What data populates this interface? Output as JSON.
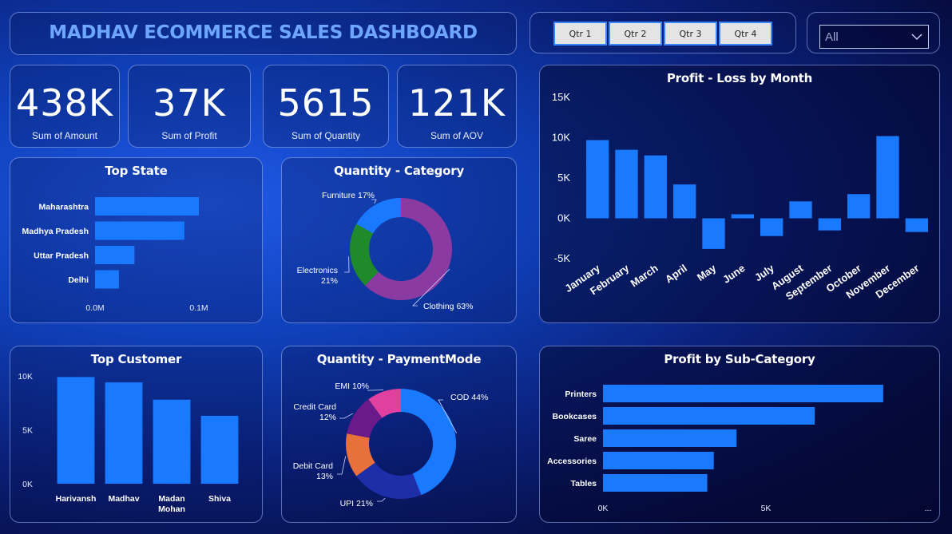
{
  "header": {
    "title": "MADHAV ECOMMERCE SALES DASHBOARD"
  },
  "quarter_buttons": [
    "Qtr 1",
    "Qtr 2",
    "Qtr 3",
    "Qtr 4"
  ],
  "filter": {
    "selected": "All"
  },
  "kpis": [
    {
      "value": "438K",
      "label": "Sum of Amount"
    },
    {
      "value": "37K",
      "label": "Sum of Profit"
    },
    {
      "value": "5615",
      "label": "Sum of Quantity"
    },
    {
      "value": "121K",
      "label": "Sum of AOV"
    }
  ],
  "colors": {
    "bar": "#1a7aff",
    "accent_title": "#6ea6ff"
  },
  "chart_data": [
    {
      "id": "top-state",
      "type": "bar",
      "orientation": "horizontal",
      "title": "Top State",
      "categories": [
        "Maharashtra",
        "Madhya Pradesh",
        "Uttar Pradesh",
        "Delhi"
      ],
      "values": [
        0.1,
        0.086,
        0.038,
        0.023
      ],
      "xticks": [
        "0.0M",
        "0.1M"
      ],
      "xlim": [
        0,
        0.1
      ]
    },
    {
      "id": "quantity-category",
      "type": "pie",
      "donut": true,
      "title": "Quantity - Category",
      "labels": [
        "Clothing 63%",
        "Electronics\n21%",
        "Furniture 17%"
      ],
      "values": [
        63,
        21,
        17
      ],
      "colors": [
        "#8a3aa0",
        "#1e8a2a",
        "#1a7aff"
      ]
    },
    {
      "id": "profit-loss-month",
      "type": "bar",
      "title": "Profit - Loss by Month",
      "categories": [
        "January",
        "February",
        "March",
        "April",
        "May",
        "June",
        "July",
        "August",
        "September",
        "October",
        "November",
        "December"
      ],
      "values": [
        9700,
        8500,
        7800,
        4200,
        -3800,
        500,
        -2200,
        2100,
        -1500,
        3000,
        10200,
        -1700
      ],
      "yticks": [
        "15K",
        "10K",
        "5K",
        "0K",
        "-5K"
      ],
      "ylim": [
        -5000,
        15000
      ]
    },
    {
      "id": "top-customer",
      "type": "bar",
      "title": "Top Customer",
      "categories": [
        "Harivansh",
        "Madhav",
        "Madan\nMohan",
        "Shiva"
      ],
      "values": [
        9900,
        9400,
        7800,
        6300
      ],
      "yticks": [
        "10K",
        "5K",
        "0K"
      ],
      "ylim": [
        0,
        10000
      ]
    },
    {
      "id": "quantity-paymentmode",
      "type": "pie",
      "donut": true,
      "title": "Quantity - PaymentMode",
      "labels": [
        "COD 44%",
        "UPI 21%",
        "Debit Card\n13%",
        "Credit Card\n12%",
        "EMI 10%"
      ],
      "values": [
        44,
        21,
        13,
        12,
        10
      ],
      "colors": [
        "#1a7aff",
        "#1e2ea8",
        "#e8703a",
        "#6a1a8a",
        "#e040a0"
      ]
    },
    {
      "id": "profit-subcategory",
      "type": "bar",
      "orientation": "horizontal",
      "title": "Profit by Sub-Category",
      "categories": [
        "Printers",
        "Bookcases",
        "Saree",
        "Accessories",
        "Tables"
      ],
      "values": [
        8600,
        6500,
        4100,
        3400,
        3200
      ],
      "xticks": [
        "0K",
        "5K",
        "..."
      ],
      "xlim": [
        0,
        10000
      ]
    }
  ]
}
